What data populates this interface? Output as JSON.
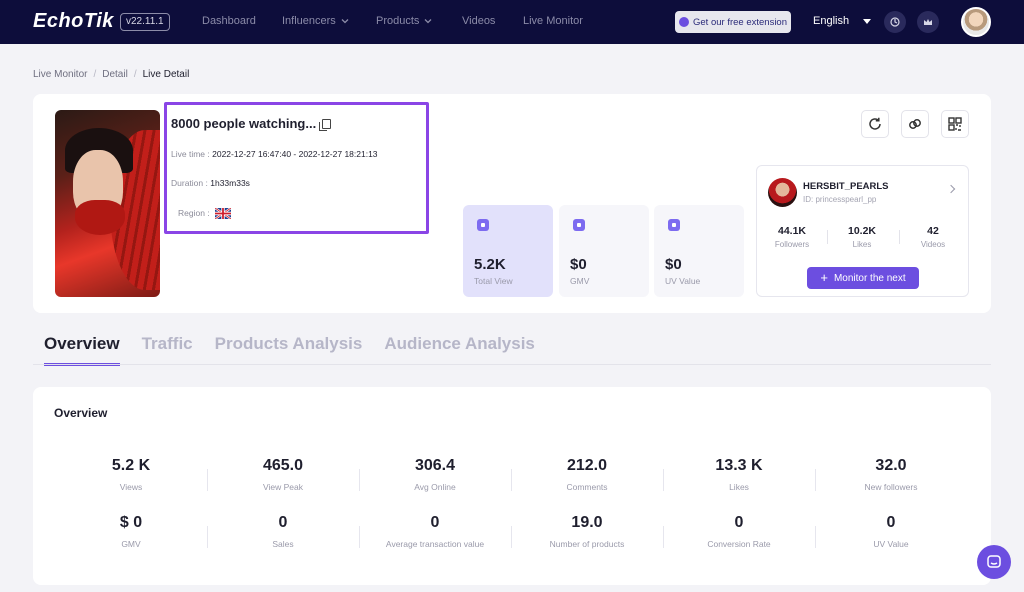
{
  "app": {
    "logo": "EchoTik",
    "version": "v22.11.1"
  },
  "nav": {
    "items": [
      {
        "label": "Dashboard",
        "dropdown": false
      },
      {
        "label": "Influencers",
        "dropdown": true
      },
      {
        "label": "Products",
        "dropdown": true
      },
      {
        "label": "Videos",
        "dropdown": false
      },
      {
        "label": "Live Monitor",
        "dropdown": false
      }
    ],
    "extension_label": "Get our free extension",
    "language": "English"
  },
  "breadcrumb": [
    "Live Monitor",
    "Detail",
    "Live Detail"
  ],
  "live": {
    "title": "8000 people watching...",
    "live_time_label": "Live time :",
    "live_time_value": "2022-12-27 16:47:40 - 2022-12-27 18:21:13",
    "duration_label": "Duration :",
    "duration_value": "1h33m33s",
    "region_label": "Region :",
    "region_flag": "uk-flag-icon"
  },
  "stats": [
    {
      "value": "5.2K",
      "label": "Total View",
      "active": true
    },
    {
      "value": "$0",
      "label": "GMV",
      "active": false
    },
    {
      "value": "$0",
      "label": "UV Value",
      "active": false
    }
  ],
  "creator": {
    "name": "HERSBIT_PEARLS",
    "id": "ID: princesspearl_pp",
    "stats": [
      {
        "value": "44.1K",
        "label": "Followers"
      },
      {
        "value": "10.2K",
        "label": "Likes"
      },
      {
        "value": "42",
        "label": "Videos"
      }
    ],
    "monitor_label": "Monitor the next"
  },
  "tabs": [
    {
      "label": "Overview",
      "active": true
    },
    {
      "label": "Traffic",
      "active": false
    },
    {
      "label": "Products Analysis",
      "active": false
    },
    {
      "label": "Audience Analysis",
      "active": false
    }
  ],
  "overview": {
    "title": "Overview",
    "row1": [
      {
        "value": "5.2 K",
        "label": "Views"
      },
      {
        "value": "465.0",
        "label": "View Peak"
      },
      {
        "value": "306.4",
        "label": "Avg Online"
      },
      {
        "value": "212.0",
        "label": "Comments"
      },
      {
        "value": "13.3 K",
        "label": "Likes"
      },
      {
        "value": "32.0",
        "label": "New followers"
      }
    ],
    "row2": [
      {
        "value": "$ 0",
        "label": "GMV"
      },
      {
        "value": "0",
        "label": "Sales"
      },
      {
        "value": "0",
        "label": "Average transaction value"
      },
      {
        "value": "19.0",
        "label": "Number of products"
      },
      {
        "value": "0",
        "label": "Conversion Rate"
      },
      {
        "value": "0",
        "label": "UV Value"
      }
    ]
  },
  "colors": {
    "nav_bg": "#0d0d3b",
    "accent": "#6c4ee0",
    "highlight": "#8a45e6"
  }
}
